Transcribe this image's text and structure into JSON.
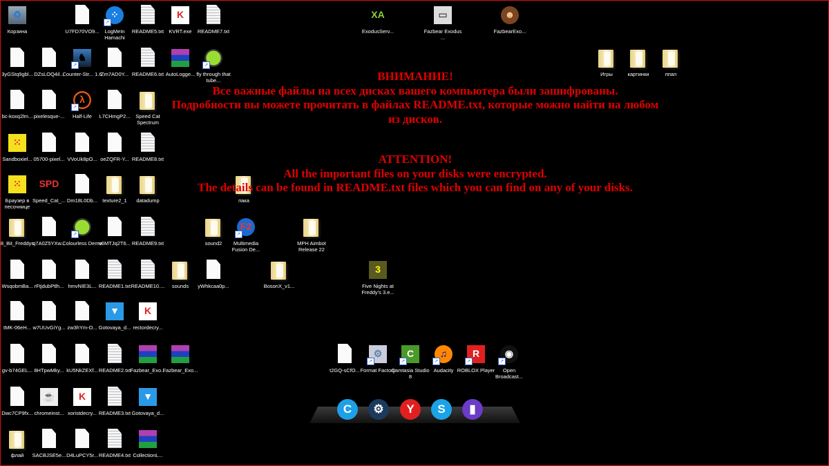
{
  "message": {
    "ru_title": "ВНИМАНИЕ!",
    "ru_line1": "Все важные файлы на всех дисках вашего компьютера были зашифрованы.",
    "ru_line2": "Подробности вы можете прочитать в файлах README.txt, которые можно найти на любом",
    "ru_line3": "из дисков.",
    "en_title": "ATTENTION!",
    "en_line1": "All the important files on your disks were encrypted.",
    "en_line2": "The details can be found in README.txt files which you can find on any of your disks."
  },
  "colors": {
    "message": "#e00000",
    "border": "#e01010",
    "background": "#000000"
  },
  "icons": [
    {
      "label": "Корзина",
      "icon": "recycle-bin-icon"
    },
    {
      "label": "U7FD70VO9...",
      "icon": "file-icon"
    },
    {
      "label": "LogMeIn Hamachi",
      "icon": "hamachi-icon"
    },
    {
      "label": "README5.txt",
      "icon": "text-file-icon"
    },
    {
      "label": "KVRT.exe",
      "icon": "kaspersky-icon"
    },
    {
      "label": "README7.txt",
      "icon": "text-file-icon"
    },
    {
      "label": "ExodusServ...",
      "icon": "exodus-icon"
    },
    {
      "label": "Fazbear Exodus ...",
      "icon": "window-icon"
    },
    {
      "label": "FazbearExo...",
      "icon": "freddy-icon"
    },
    {
      "label": "3yGStq9gbl...",
      "icon": "file-icon"
    },
    {
      "label": "DZsLOQ4il...",
      "icon": "file-icon"
    },
    {
      "label": "Counter-Str... 1.6",
      "icon": "counter-strike-icon"
    },
    {
      "label": "Zm7AD0Y...",
      "icon": "file-icon"
    },
    {
      "label": "README6.txt",
      "icon": "text-file-icon"
    },
    {
      "label": "AutoLogge...",
      "icon": "winrar-icon"
    },
    {
      "label": "fly through that tube...",
      "icon": "gear-icon"
    },
    {
      "label": "Игры",
      "icon": "folder-icon"
    },
    {
      "label": "картинки",
      "icon": "folder-icon"
    },
    {
      "label": "ппап",
      "icon": "folder-icon"
    },
    {
      "label": "bc-koxq2lm...",
      "icon": "file-icon"
    },
    {
      "label": "pixelesque-...",
      "icon": "file-icon"
    },
    {
      "label": "Half-Life",
      "icon": "half-life-icon"
    },
    {
      "label": "L7CHmgP2...",
      "icon": "file-icon"
    },
    {
      "label": "Speed Cat Spectrum",
      "icon": "folder-icon"
    },
    {
      "label": "Sandboxiel...",
      "icon": "sandboxie-icon"
    },
    {
      "label": "05700-pixel...",
      "icon": "file-icon"
    },
    {
      "label": "VVoUk8pO...",
      "icon": "file-icon"
    },
    {
      "label": "oeZQFR-Y...",
      "icon": "file-icon"
    },
    {
      "label": "README8.txt",
      "icon": "text-file-icon"
    },
    {
      "label": "Браузер в песочнице",
      "icon": "sandboxie-icon"
    },
    {
      "label": "Speed_Cat_...",
      "icon": "speed-cat-icon"
    },
    {
      "label": "Dm18L0Db...",
      "icon": "file-icon"
    },
    {
      "label": "texture2_1",
      "icon": "folder-icon"
    },
    {
      "label": "datadump",
      "icon": "folder-icon"
    },
    {
      "label": "пака",
      "icon": "folder-icon"
    },
    {
      "label": "8_Bit_Freddys",
      "icon": "folder-icon"
    },
    {
      "label": "q7A0Z5YXw...",
      "icon": "file-icon"
    },
    {
      "label": "Colourless Demo",
      "icon": "gear-icon"
    },
    {
      "label": "v6MTJq2T6...",
      "icon": "file-icon"
    },
    {
      "label": "README9.txt",
      "icon": "text-file-icon"
    },
    {
      "label": "sound2",
      "icon": "folder-icon"
    },
    {
      "label": "Multimedia Fusion De...",
      "icon": "fusion-icon"
    },
    {
      "label": "MPH Aimbot Release 22",
      "icon": "folder-icon"
    },
    {
      "label": "WsqobmBa...",
      "icon": "file-icon"
    },
    {
      "label": "rFtjdubPtlh...",
      "icon": "file-icon"
    },
    {
      "label": "hmvNIE3L...",
      "icon": "file-icon"
    },
    {
      "label": "README1.txt",
      "icon": "text-file-icon"
    },
    {
      "label": "README10....",
      "icon": "text-file-icon"
    },
    {
      "label": "sounds",
      "icon": "folder-icon"
    },
    {
      "label": "yWhkcaa0p...",
      "icon": "file-icon"
    },
    {
      "label": "BosonX_v1...",
      "icon": "folder-icon"
    },
    {
      "label": "Five Nights at Freddy's 3.e...",
      "icon": "fnaf3-icon"
    },
    {
      "label": "tMK-06eH...",
      "icon": "file-icon"
    },
    {
      "label": "w7UUvGiYg...",
      "icon": "file-icon"
    },
    {
      "label": "zw3hYm-O...",
      "icon": "file-icon"
    },
    {
      "label": "Gotovaya_d...",
      "icon": "docx-icon"
    },
    {
      "label": "rectordecry...",
      "icon": "kaspersky-icon"
    },
    {
      "label": "gv-b74GEL...",
      "icon": "file-icon"
    },
    {
      "label": "8HTpwMky...",
      "icon": "file-icon"
    },
    {
      "label": "kU5NkZEXf...",
      "icon": "file-icon"
    },
    {
      "label": "README2.txt",
      "icon": "text-file-icon"
    },
    {
      "label": "Fazbear_Exo...",
      "icon": "winrar-icon"
    },
    {
      "label": "Fazbear_Exo...",
      "icon": "winrar-icon"
    },
    {
      "label": "t2GQ-sCfO...",
      "icon": "file-icon"
    },
    {
      "label": "Format Factory",
      "icon": "format-factory-icon"
    },
    {
      "label": "Camtasia Studio 8",
      "icon": "camtasia-icon"
    },
    {
      "label": "Audacity",
      "icon": "audacity-icon"
    },
    {
      "label": "ROBLOX Player",
      "icon": "roblox-icon"
    },
    {
      "label": "Open Broadcast...",
      "icon": "obs-icon"
    },
    {
      "label": "Dwc7CP9fx...",
      "icon": "file-icon"
    },
    {
      "label": "chromeinst...",
      "icon": "java-installer-icon"
    },
    {
      "label": "xoristdecry...",
      "icon": "kaspersky-icon"
    },
    {
      "label": "README3.txt",
      "icon": "text-file-icon"
    },
    {
      "label": "Gotovaya_d...",
      "icon": "docx-icon"
    },
    {
      "label": "флай",
      "icon": "folder-icon"
    },
    {
      "label": "SACBJSE5e...",
      "icon": "file-icon"
    },
    {
      "label": "D4LuPCY5r...",
      "icon": "file-icon"
    },
    {
      "label": "README4.txt",
      "icon": "text-file-icon"
    },
    {
      "label": "CollectionL...",
      "icon": "winrar-icon"
    }
  ],
  "dock": [
    {
      "icon": "advanced-systemcare-icon",
      "glyph": "C",
      "color": "#1ea0e8"
    },
    {
      "icon": "steam-icon",
      "glyph": "⚙",
      "color": "#1b3a5c"
    },
    {
      "icon": "yandex-browser-icon",
      "glyph": "Y",
      "color": "#e02020"
    },
    {
      "icon": "skype-icon",
      "glyph": "S",
      "color": "#1aa3e8"
    },
    {
      "icon": "network-meter-icon",
      "glyph": "▮",
      "color": "#6a3cc8"
    }
  ]
}
